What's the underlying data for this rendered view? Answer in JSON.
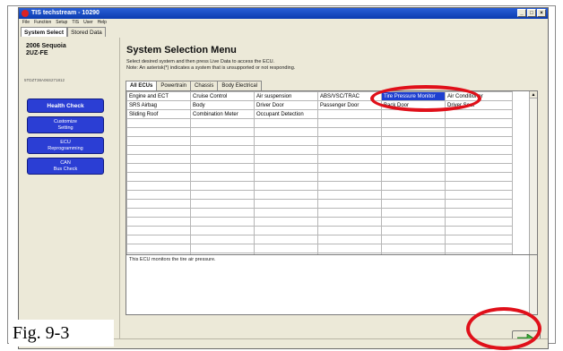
{
  "window": {
    "title": "TIS techstream - 10290",
    "controls": [
      "_",
      "□",
      "×"
    ]
  },
  "menu": [
    "File",
    "Function",
    "Setup",
    "TIS",
    "User",
    "Help"
  ],
  "top_tabs": [
    {
      "label": "System Select",
      "active": true
    },
    {
      "label": "Stored Data",
      "active": false
    }
  ],
  "vehicle": {
    "model": "2006 Sequoia",
    "engine": "2UZ-FE",
    "vin": "5TDZT38A06S271812"
  },
  "side_buttons": [
    {
      "lines": [
        "Health Check"
      ],
      "bold": true
    },
    {
      "lines": [
        "Customize",
        "Setting"
      ],
      "bold": false
    },
    {
      "lines": [
        "ECU",
        "Reprogramming"
      ],
      "bold": false
    },
    {
      "lines": [
        "CAN",
        "Bus Check"
      ],
      "bold": false
    }
  ],
  "main": {
    "title": "System Selection Menu",
    "instruction1": "Select desired system and then press Live Data to access the ECU.",
    "instruction2": "Note: An asterisk(*) indicates a system that is unsupported or not responding.",
    "category_tabs": [
      {
        "label": "All ECUs",
        "active": true
      },
      {
        "label": "Powertrain",
        "active": false
      },
      {
        "label": "Chassis",
        "active": false
      },
      {
        "label": "Body Electrical",
        "active": false
      }
    ],
    "grid": [
      [
        "Engine and ECT",
        "Cruise Control",
        "Air suspension",
        "ABS/VSC/TRAC",
        "Tire Pressure Monitor",
        "Air Conditioner"
      ],
      [
        "SRS Airbag",
        "Body",
        "Driver Door",
        "Passenger Door",
        "Back Door",
        "Driver Seat"
      ],
      [
        "Sliding Roof",
        "Combination Meter",
        "Occupant Detection",
        "",
        "",
        ""
      ]
    ],
    "selected": {
      "row": 0,
      "col": 4
    },
    "description": "This ECU monitors the tire air pressure."
  },
  "figure_label": "Fig. 9-3",
  "colors": {
    "annotation": "#e0101a",
    "selection": "#1e3fd0",
    "side_button": "#2b3ed4",
    "next_arrow": "#3cae3c"
  }
}
